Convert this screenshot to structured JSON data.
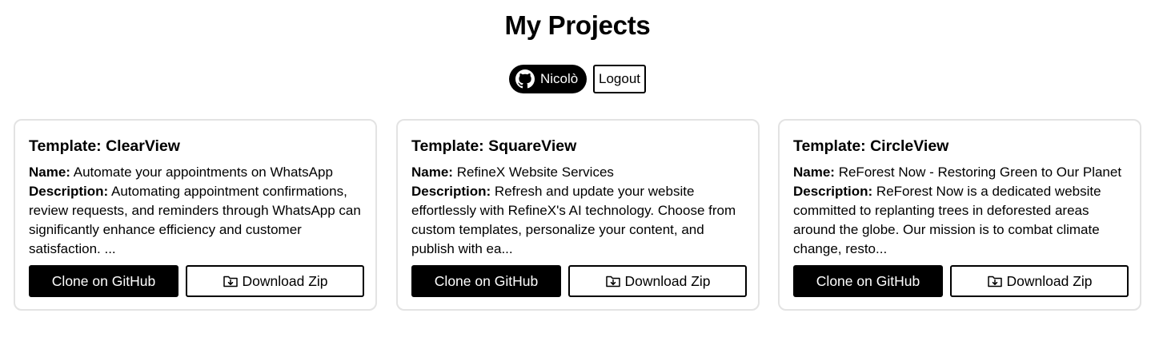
{
  "page": {
    "title": "My Projects"
  },
  "user": {
    "name": "Nicolò",
    "avatar_icon": "github-icon",
    "logout_label": "Logout"
  },
  "labels": {
    "name": "Name:",
    "description": "Description:"
  },
  "actions": {
    "clone_label": "Clone on GitHub",
    "download_label": "Download Zip",
    "download_icon": "folder-download-icon"
  },
  "projects": [
    {
      "template": "Template: ClearView",
      "name": "Automate your appointments on WhatsApp",
      "description": "Automating appointment confirmations, review requests, and reminders through WhatsApp can significantly enhance efficiency and customer satisfaction. ..."
    },
    {
      "template": "Template: SquareView",
      "name": "RefineX Website Services",
      "description": "Refresh and update your website effortlessly with RefineX's AI technology. Choose from custom templates, personalize your content, and publish with ea..."
    },
    {
      "template": "Template: CircleView",
      "name": "ReForest Now - Restoring Green to Our Planet",
      "description": "ReForest Now is a dedicated website committed to replanting trees in deforested areas around the globe. Our mission is to combat climate change, resto..."
    }
  ]
}
